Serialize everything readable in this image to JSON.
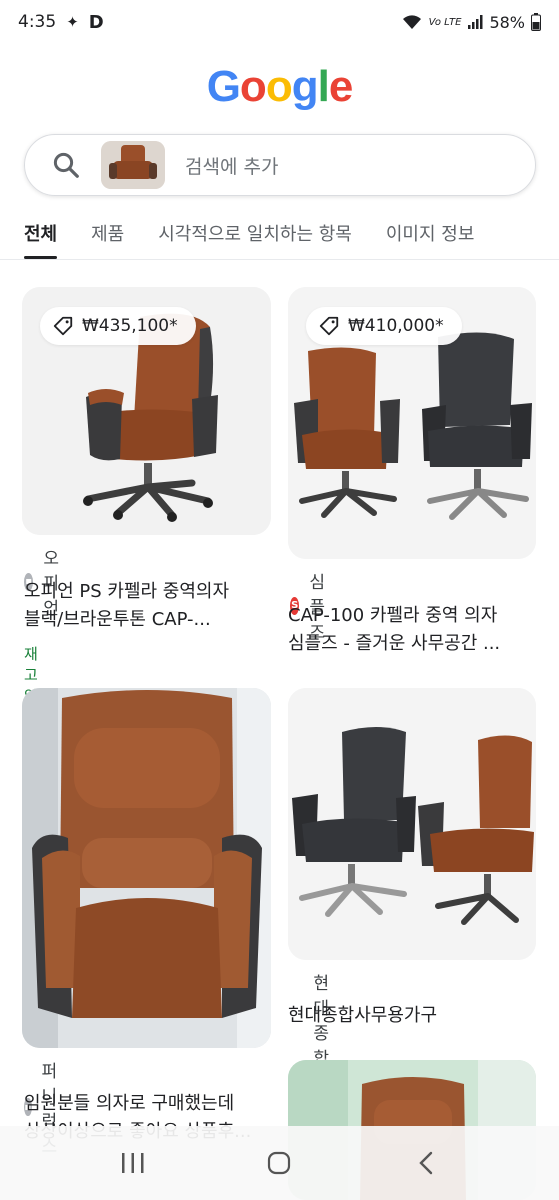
{
  "status_bar": {
    "time": "4:35",
    "app_icon_label": "D",
    "battery": "58%",
    "network": "Vo LTE"
  },
  "logo": {
    "letters": [
      "G",
      "o",
      "o",
      "g",
      "l",
      "e"
    ],
    "colors": [
      "#4285F4",
      "#EA4335",
      "#FBBC05",
      "#4285F4",
      "#34A853",
      "#EA4335"
    ]
  },
  "search": {
    "placeholder": "검색에 추가"
  },
  "tabs": [
    {
      "label": "전체",
      "active": true
    },
    {
      "label": "제품",
      "active": false
    },
    {
      "label": "시각적으로 일치하는 항목",
      "active": false
    },
    {
      "label": "이미지 정보",
      "active": false
    }
  ],
  "results": [
    {
      "price": "₩435,100*",
      "source": "오피언",
      "title_line1": "오피언 PS 카펠라 중역의자",
      "title_line2": "블랙/브라운투톤 CAP-...",
      "stock": "재고 있음"
    },
    {
      "price": "₩410,000*",
      "source": "심플즈",
      "title_line1": "CAP-100 카펠라 중역 의자",
      "title_line2": "심플즈 - 즐거운 사무공간 ..."
    },
    {
      "source": "퍼니럭스",
      "title_line1": "임원분들 의자로 구매했는데",
      "title_line2": "상상이상으로 좋아요 상품후..."
    },
    {
      "source": "현대종합사무용가구",
      "title_line1": "현대종합사무용가구"
    }
  ],
  "colors": {
    "accent_green": "#188038",
    "leather_brown": "#9a4f2a",
    "leather_black": "#3a3c40"
  }
}
